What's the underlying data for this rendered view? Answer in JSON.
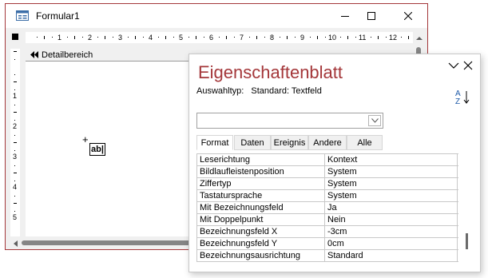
{
  "form_window": {
    "title": "Formular1",
    "section_label": "Detailbereich",
    "textbox_glyph": "ab|",
    "cursor_glyph": "+",
    "h_ruler_numbers": [
      "1",
      "2",
      "3",
      "4",
      "5",
      "6",
      "7",
      "8",
      "9",
      "10",
      "11",
      "12"
    ],
    "v_ruler_numbers": [
      "1",
      "2",
      "3",
      "4",
      "5"
    ],
    "accent_color": "#a4373a"
  },
  "property_sheet": {
    "title": "Eigenschaftenblatt",
    "selection_type_label": "Auswahltyp:",
    "selection_type_value": "Standard: Textfeld",
    "dropdown_value": "",
    "sort_icon": "sort-az-icon",
    "tabs": [
      {
        "label": "Format",
        "active": true
      },
      {
        "label": "Daten",
        "active": false
      },
      {
        "label": "Ereignis",
        "active": false
      },
      {
        "label": "Andere",
        "active": false
      },
      {
        "label": "Alle",
        "active": false
      }
    ],
    "properties": [
      {
        "name": "Leserichtung",
        "value": "Kontext"
      },
      {
        "name": "Bildlaufleistenposition",
        "value": "System"
      },
      {
        "name": "Ziffertyp",
        "value": "System"
      },
      {
        "name": "Tastatursprache",
        "value": "System"
      },
      {
        "name": "Mit Bezeichnungsfeld",
        "value": "Ja"
      },
      {
        "name": "Mit Doppelpunkt",
        "value": "Nein"
      },
      {
        "name": "Bezeichnungsfeld X",
        "value": "-3cm"
      },
      {
        "name": "Bezeichnungsfeld Y",
        "value": "0cm"
      },
      {
        "name": "Bezeichnungsausrichtung",
        "value": "Standard"
      }
    ]
  }
}
